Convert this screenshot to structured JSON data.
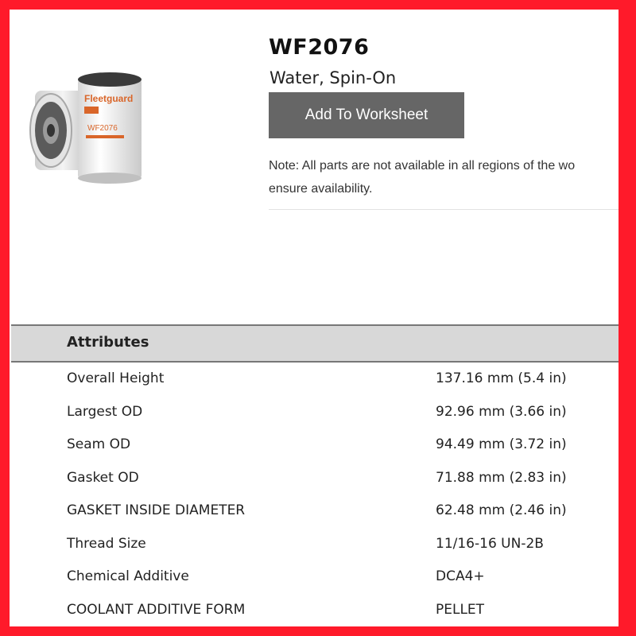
{
  "product": {
    "part_number": "WF2076",
    "description": "Water, Spin-On",
    "add_button_label": "Add To Worksheet",
    "note_line1": "Note: All parts are not available in all regions of the wo",
    "note_line2": "ensure availability.",
    "image": {
      "brand_text": "Fleetguard",
      "label_text": "WF2076"
    }
  },
  "attributes": {
    "header": "Attributes",
    "rows": [
      {
        "name": "Overall Height",
        "value": "137.16 mm (5.4 in)"
      },
      {
        "name": "Largest OD",
        "value": "92.96 mm (3.66 in)"
      },
      {
        "name": "Seam OD",
        "value": "94.49 mm (3.72 in)"
      },
      {
        "name": "Gasket OD",
        "value": "71.88 mm (2.83 in)"
      },
      {
        "name": "GASKET INSIDE DIAMETER",
        "value": "62.48 mm (2.46 in)"
      },
      {
        "name": "Thread Size",
        "value": "11/16-16 UN-2B"
      },
      {
        "name": "Chemical Additive",
        "value": "DCA4+"
      },
      {
        "name": "COOLANT ADDITIVE FORM",
        "value": "PELLET"
      }
    ]
  },
  "colors": {
    "frame_border": "#ff1a2a",
    "button_bg": "#666666",
    "header_bg": "#d8d8d8",
    "brand_orange": "#d9662a"
  }
}
